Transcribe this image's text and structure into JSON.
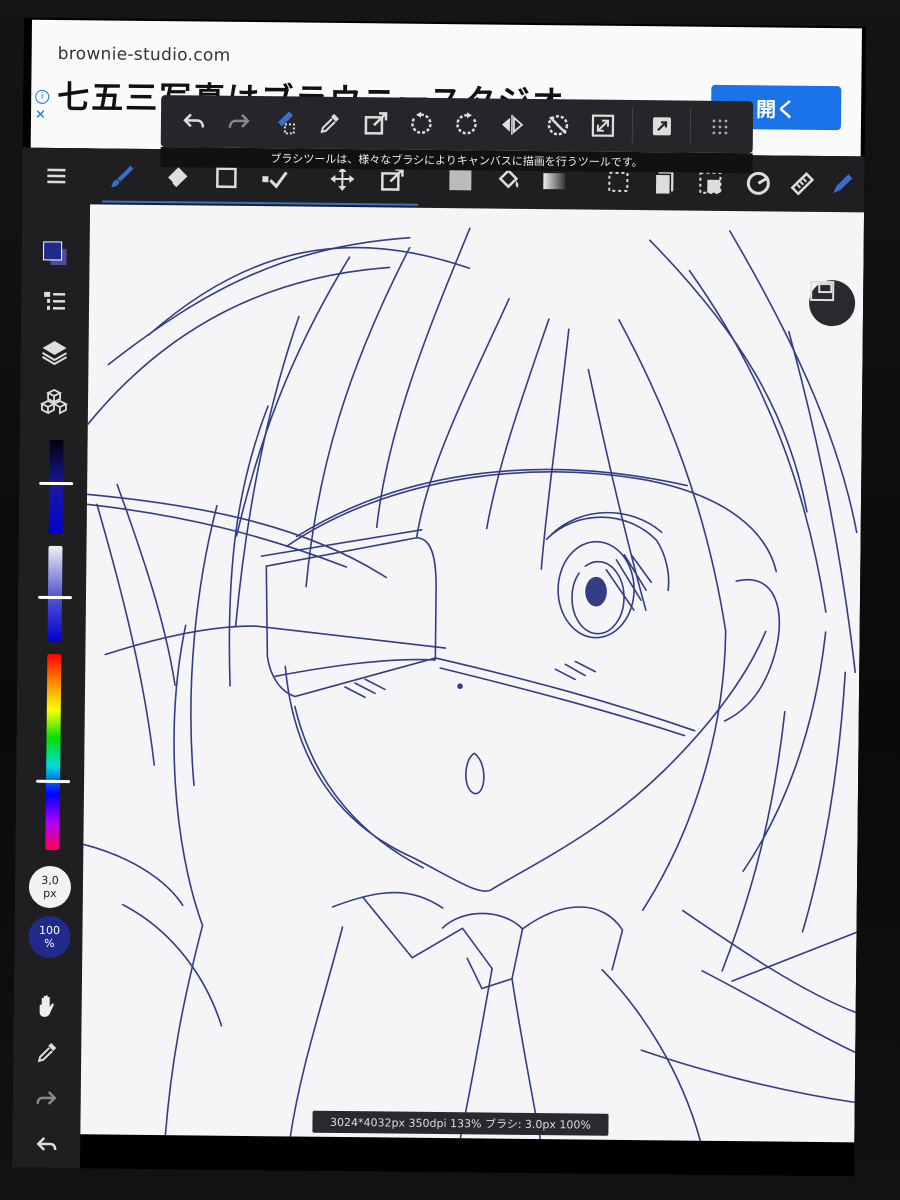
{
  "ad": {
    "domain": "brownie-studio.com",
    "headline": "七五三写真はブラウニースタジオ",
    "open_label": "開く",
    "info_glyph": "i",
    "close_glyph": "✕"
  },
  "tooltip": "ブラシツールは、様々なブラシによりキャンバスに描画を行うツールです。",
  "sidebar": {
    "brush_size": "3,0",
    "brush_size_unit": "px",
    "opacity": "100",
    "opacity_unit": "%",
    "primary_color": "#1f2a8a",
    "secondary_color": "#4a4f9a"
  },
  "status_bar": "3024*4032px 350dpi 133% ブラシ: 3.0px 100%",
  "colors": {
    "accent": "#3a6ec9",
    "sketch_line": "#1f2a7a",
    "ad_button": "#1a73e8"
  },
  "icons": {
    "float_bar": [
      "undo-icon",
      "redo-icon",
      "lasso-fill-icon",
      "eyedropper-icon",
      "transform-icon",
      "rotate-left-icon",
      "rotate-right-icon",
      "flip-icon",
      "reset-rotation-icon",
      "fit-screen-icon",
      "export-icon",
      "grid-menu-icon"
    ],
    "top_tools": [
      "brush-icon",
      "eraser-icon",
      "shape-icon",
      "selection-brush-icon",
      "move-icon",
      "transform-icon",
      "fill-icon",
      "bucket-icon",
      "gradient-icon",
      "select-rect-icon",
      "copy-layer-icon",
      "select-layer-icon",
      "perspective-icon",
      "ruler-icon",
      "pen-icon"
    ]
  }
}
